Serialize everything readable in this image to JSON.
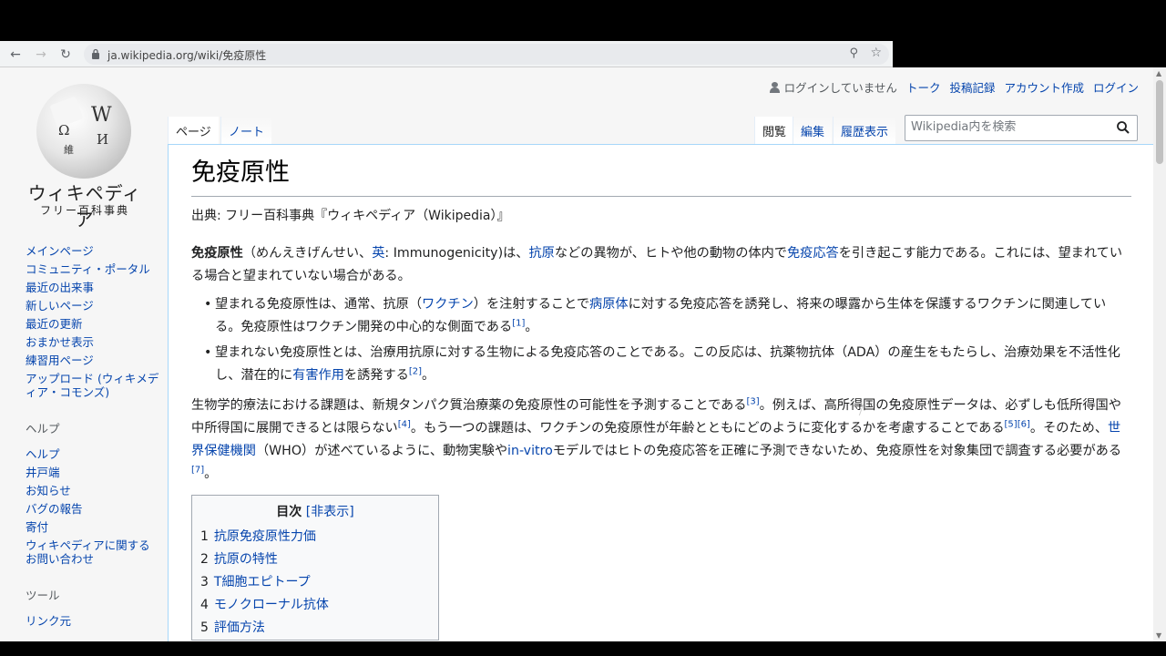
{
  "browser": {
    "url": "ja.wikipedia.org/wiki/免疫原性"
  },
  "logo": {
    "title": "ウィキペディア",
    "subtitle": "フリー百科事典",
    "globe_glyphs": [
      "W",
      "Ω",
      "И",
      "維"
    ]
  },
  "personal_tools": {
    "status": "ログインしていません",
    "talk": "トーク",
    "contributions": "投稿記録",
    "create_account": "アカウント作成",
    "login": "ログイン"
  },
  "tabs": {
    "page": "ページ",
    "note": "ノート",
    "read": "閲覧",
    "edit": "編集",
    "history": "履歴表示"
  },
  "search": {
    "placeholder": "Wikipedia内を検索"
  },
  "sidebar": {
    "nav": [
      "メインページ",
      "コミュニティ・ポータル",
      "最近の出来事",
      "新しいページ",
      "最近の更新",
      "おまかせ表示",
      "練習用ページ",
      "アップロード (ウィキメディア・コモンズ)"
    ],
    "help_heading": "ヘルプ",
    "help": [
      "ヘルプ",
      "井戸端",
      "お知らせ",
      "バグの報告",
      "寄付",
      "ウィキペディアに関するお問い合わせ"
    ],
    "tools_heading": "ツール",
    "tools": [
      "リンク元"
    ]
  },
  "article": {
    "title": "免疫原性",
    "site_sub": "出典: フリー百科事典『ウィキペディア（Wikipedia）』",
    "p1": {
      "bold": "免疫原性",
      "t1": "（めんえきげんせい、",
      "link_en": "英",
      "t2": ": Immunogenicity)は、",
      "link_antigen": "抗原",
      "t3": "などの異物が、ヒトや他の動物の体内で",
      "link_immune": "免疫応答",
      "t4": "を引き起こす能力である。これには、望まれている場合と望まれていない場合がある。"
    },
    "b1": {
      "t1": "望まれる免疫原性は、通常、抗原（",
      "link_vaccine": "ワクチン",
      "t2": "）を注射することで",
      "link_pathogen": "病原体",
      "t3": "に対する免疫応答を誘発し、将来の曝露から生体を保護するワクチンに関連している。免疫原性はワクチン開発の中心的な側面である",
      "ref": "[1]",
      "t4": "。"
    },
    "b2": {
      "t1": "望まれない免疫原性とは、治療用抗原に対する生物による免疫応答のことである。この反応は、抗薬物抗体（ADA）の産生をもたらし、治療効果を不活性化し、潜在的に",
      "link_adverse": "有害作用",
      "t2": "を誘発する",
      "ref": "[2]",
      "t3": "。"
    },
    "p2": {
      "t1": "生物学的療法における課題は、新規タンパク質治療薬の免疫原性の可能性を予測することである",
      "ref3": "[3]",
      "t2": "。例えば、高所得国の免疫原性データは、必ずしも低所得国や中所得国に展開できるとは限らない",
      "ref4": "[4]",
      "t3": "。もう一つの課題は、ワクチンの免疫原性が年齢とともにどのように変化するかを考慮することである",
      "ref5": "[5]",
      "ref6": "[6]",
      "t4": "。そのため、",
      "link_who": "世界保健機関",
      "t5": "（WHO）が述べているように、動物実験や",
      "link_invitro": "in-vitro",
      "t6": "モデルではヒトの免疫応答を正確に予測できないため、免疫原性を対象集団で調査する必要がある",
      "ref7": "[7]",
      "t7": "。"
    }
  },
  "toc": {
    "title": "目次",
    "toggle": "[非表示]",
    "items": [
      {
        "num": "1",
        "label": "抗原免疫原性力価"
      },
      {
        "num": "2",
        "label": "抗原の特性"
      },
      {
        "num": "3",
        "label": "T細胞エピトープ"
      },
      {
        "num": "4",
        "label": "モノクローナル抗体"
      },
      {
        "num": "5",
        "label": "評価方法"
      }
    ]
  }
}
